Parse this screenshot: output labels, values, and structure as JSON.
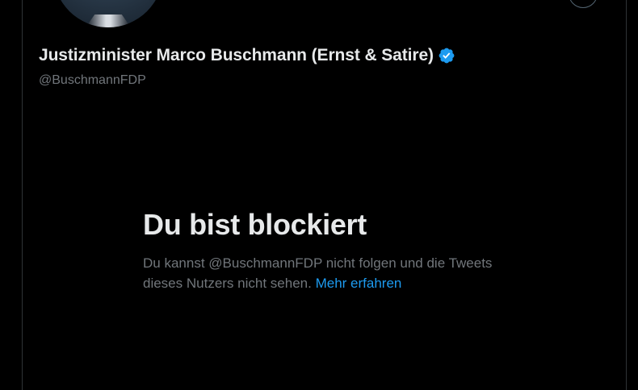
{
  "profile": {
    "display_name": "Justizminister Marco Buschmann (Ernst & Satire)",
    "handle": "@BuschmannFDP",
    "verified_icon": "verified-badge-icon",
    "avatar_icon": "profile-avatar"
  },
  "blocked": {
    "title": "Du bist blockiert",
    "description": "Du kannst @BuschmannFDP nicht folgen und die Tweets dieses Nutzers nicht sehen.",
    "learn_more": "Mehr erfahren"
  },
  "colors": {
    "background": "#000000",
    "text_primary": "#e7e9ea",
    "text_secondary": "#71767b",
    "accent": "#1d9bf0",
    "border": "#2f3336"
  }
}
